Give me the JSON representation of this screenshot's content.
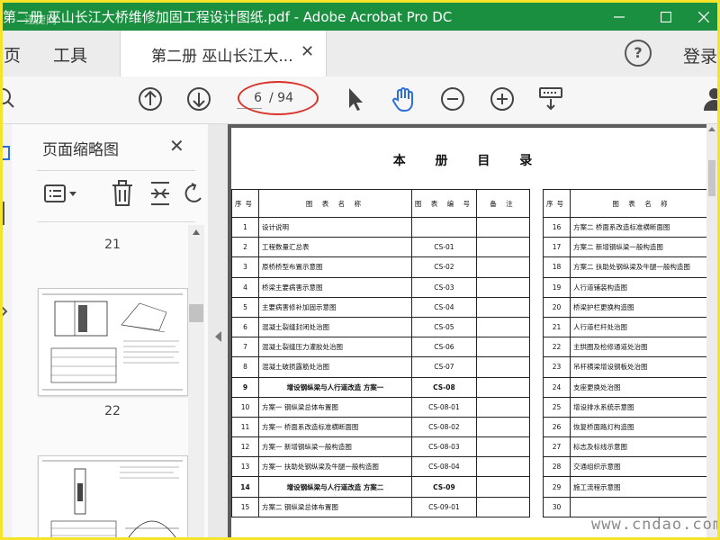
{
  "window": {
    "title": "第二册 巫山长江大桥维修加固工程设计图纸.pdf - Adobe Acrobat Pro DC",
    "watermark_top": "迅捷网"
  },
  "tabs": {
    "home_label": "主页",
    "tools_label": "工具",
    "doc_tab_label": "第二册 巫山长江大...",
    "login_label": "登录"
  },
  "toolbar": {
    "current_page": "6",
    "total_pages": "/ 94"
  },
  "panel": {
    "title": "页面缩略图",
    "thumbnails": [
      {
        "page": "21"
      },
      {
        "page": "22"
      }
    ]
  },
  "document": {
    "title": "本 册 目 录",
    "table_headers": {
      "seq": "序号",
      "name": "图 表 名 称",
      "code": "图 表 编 号",
      "note": "备 注"
    },
    "left_rows": [
      {
        "n": "1",
        "name": "设计说明",
        "code": "",
        "bold": false
      },
      {
        "n": "2",
        "name": "工程数量汇总表",
        "code": "CS-01",
        "bold": false
      },
      {
        "n": "3",
        "name": "原桥桥型布置示意图",
        "code": "CS-02",
        "bold": false
      },
      {
        "n": "4",
        "name": "桥梁主要病害示意图",
        "code": "CS-03",
        "bold": false
      },
      {
        "n": "5",
        "name": "主要病害修补加固示意图",
        "code": "CS-04",
        "bold": false
      },
      {
        "n": "6",
        "name": "混凝土裂缝封闭处治图",
        "code": "CS-05",
        "bold": false
      },
      {
        "n": "7",
        "name": "混凝土裂缝压力灌胶处治图",
        "code": "CS-06",
        "bold": false
      },
      {
        "n": "8",
        "name": "混凝土破损露筋处治图",
        "code": "CS-07",
        "bold": false
      },
      {
        "n": "9",
        "name": "增设钢纵梁与人行道改造 方案一",
        "code": "CS-08",
        "bold": true
      },
      {
        "n": "10",
        "name": "方案一 钢纵梁总体布置图",
        "code": "CS-08-01",
        "bold": false
      },
      {
        "n": "11",
        "name": "方案一 桥面系改造标准横断面图",
        "code": "CS-08-02",
        "bold": false
      },
      {
        "n": "12",
        "name": "方案一 新增钢纵梁一般构造图",
        "code": "CS-08-03",
        "bold": false
      },
      {
        "n": "13",
        "name": "方案一 扶助处钢纵梁及牛腿一般构造图",
        "code": "CS-08-04",
        "bold": false
      },
      {
        "n": "14",
        "name": "增设钢纵梁与人行道改造 方案二",
        "code": "CS-09",
        "bold": true
      },
      {
        "n": "15",
        "name": "方案二 钢纵梁总体布置图",
        "code": "CS-09-01",
        "bold": false
      }
    ],
    "right_rows": [
      {
        "n": "16",
        "name": "方案二 桥面系改造标准横断面图"
      },
      {
        "n": "17",
        "name": "方案二 新增钢纵梁一般构造图"
      },
      {
        "n": "18",
        "name": "方案二 扶助处钢纵梁及牛腿一般构造图"
      },
      {
        "n": "19",
        "name": "人行道铺装构造图"
      },
      {
        "n": "20",
        "name": "桥梁护栏更换构造图"
      },
      {
        "n": "21",
        "name": "人行道栏杆处治图"
      },
      {
        "n": "22",
        "name": "主拱圈及检修通道处治图"
      },
      {
        "n": "23",
        "name": "吊杆横梁增设钢板处治图"
      },
      {
        "n": "24",
        "name": "支座更换处治图"
      },
      {
        "n": "25",
        "name": "增设排水系统示意图"
      },
      {
        "n": "26",
        "name": "恢复桥面路灯构造图"
      },
      {
        "n": "27",
        "name": "标志及标线示意图"
      },
      {
        "n": "28",
        "name": "交通组织示意图"
      },
      {
        "n": "29",
        "name": "施工流程示意图"
      },
      {
        "n": "30",
        "name": ""
      }
    ]
  },
  "watermark_bottom": "www.cndao.com",
  "colors": {
    "titlebar": "#1a8f3f",
    "accent_blue": "#2d6fd8",
    "annotation_red": "#d9332a",
    "frame_yellow": "#f5e42a"
  }
}
